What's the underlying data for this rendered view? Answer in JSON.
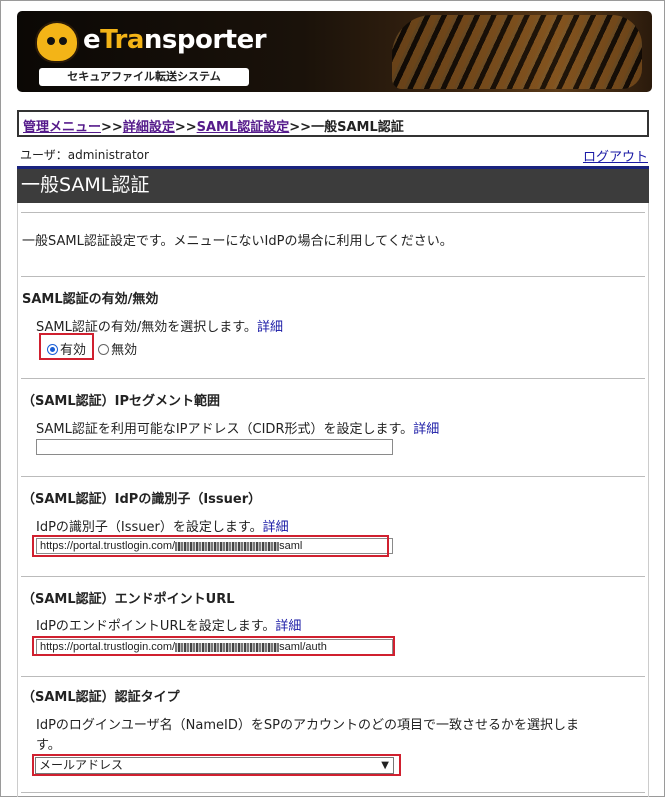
{
  "header": {
    "logo_text_prefix": "e",
    "logo_text_tr": "Tra",
    "logo_text_suffix": "nsporter",
    "logo_subtitle": "セキュアファイル転送システム"
  },
  "breadcrumb": {
    "items": [
      "管理メニュー",
      "詳細設定",
      "SAML認証設定"
    ],
    "separator": ">>",
    "current": "一般SAML認証"
  },
  "user": {
    "label": "ユーザ：administrator",
    "logout": "ログアウト"
  },
  "page": {
    "title": "一般SAML認証",
    "intro": "一般SAML認証設定です。メニューにないIdPの場合に利用してください。"
  },
  "sections": {
    "enable": {
      "title": "SAML認証の有効/無効",
      "desc": "SAML認証の有効/無効を選択します。",
      "detail": "詳細",
      "option_on": "有効",
      "option_off": "無効",
      "selected": "有効"
    },
    "ip": {
      "title": "（SAML認証）IPセグメント範囲",
      "desc": "SAML認証を利用可能なIPアドレス（CIDR形式）を設定します。",
      "detail": "詳細",
      "value": ""
    },
    "issuer": {
      "title": "（SAML認証）IdPの識別子（Issuer）",
      "desc": "IdPの識別子（Issuer）を設定します。",
      "detail": "詳細",
      "value_prefix": "https://portal.trustlogin.com/",
      "value_suffix": "saml"
    },
    "endpoint": {
      "title": "（SAML認証）エンドポイントURL",
      "desc": "IdPのエンドポイントURLを設定します。",
      "detail": "詳細",
      "value_prefix": "https://portal.trustlogin.com/",
      "value_suffix": "saml/auth"
    },
    "auth_type": {
      "title": "（SAML認証）認証タイプ",
      "desc_line1": "IdPのログインユーザ名（NameID）をSPのアカウントのどの項目で一致させるかを選択しま",
      "desc_line2": "す。",
      "selected": "メールアドレス"
    }
  },
  "colors": {
    "highlight": "#d0202f",
    "link": "#1a1aa6",
    "title_bar": "#3c3c3c"
  }
}
